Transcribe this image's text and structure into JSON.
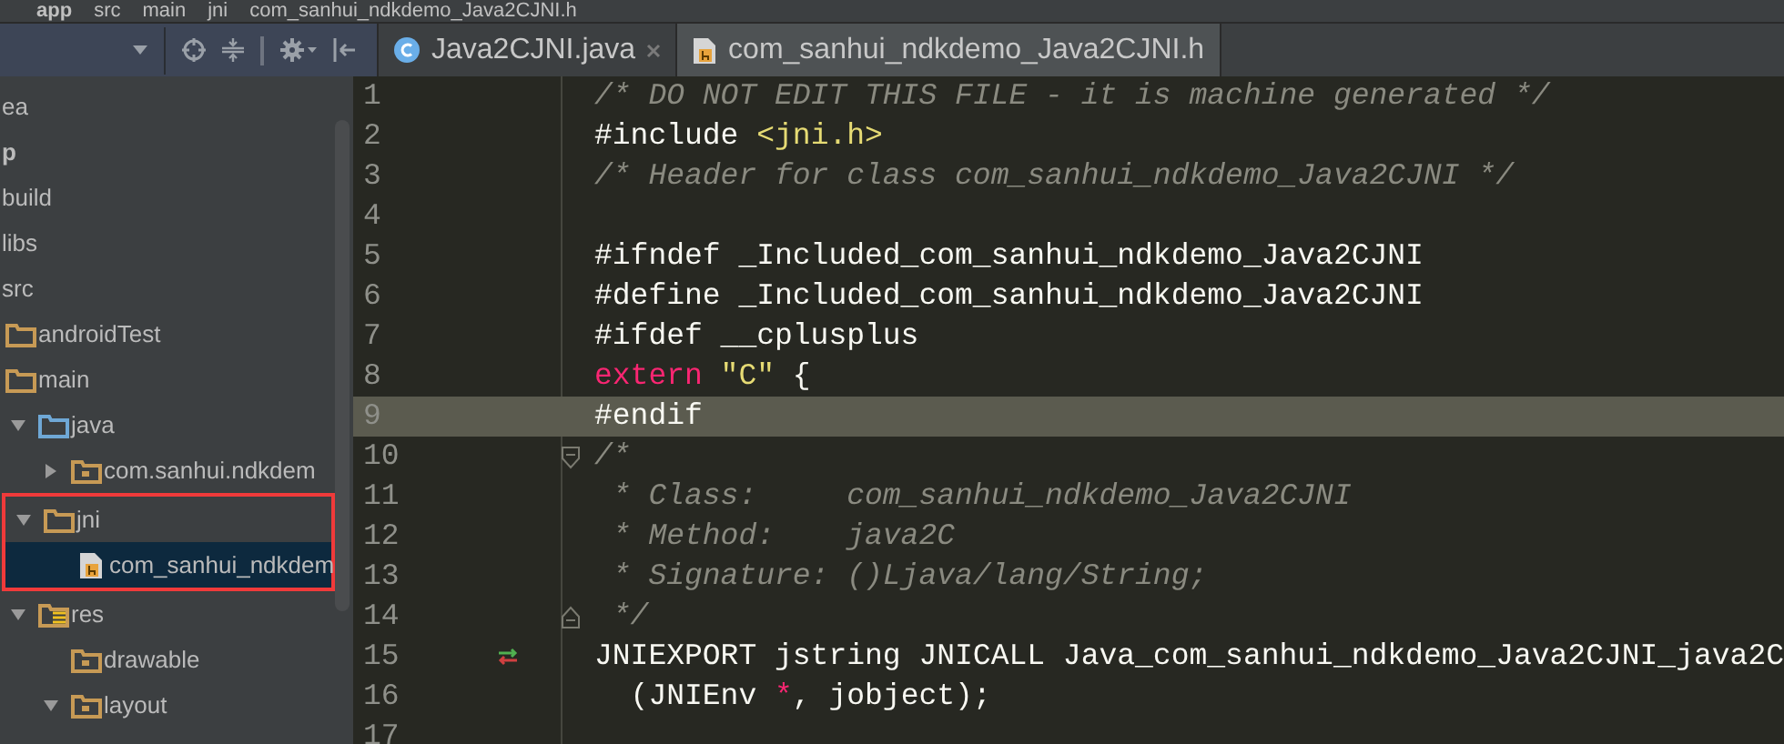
{
  "breadcrumbs": [
    {
      "label": "app",
      "bold": true
    },
    {
      "label": "src",
      "bold": false
    },
    {
      "label": "main",
      "bold": false
    },
    {
      "label": "jni",
      "bold": false
    },
    {
      "label": "com_sanhui_ndkdemo_Java2CJNI.h",
      "bold": false
    }
  ],
  "tabs": [
    {
      "label": "Java2CJNI.java",
      "kind": "class",
      "selected": false,
      "closable": true
    },
    {
      "label": "com_sanhui_ndkdemo_Java2CJNI.h",
      "kind": "header",
      "selected": true,
      "closable": false
    }
  ],
  "tree": [
    {
      "label": "ea",
      "bold": false
    },
    {
      "label": "p",
      "bold": true,
      "children": [
        {
          "label": "build",
          "bold": false
        },
        {
          "label": "libs",
          "bold": false
        },
        {
          "label": "src",
          "bold": false,
          "children": [
            {
              "label": "androidTest",
              "kind": "folder",
              "bold": false
            },
            {
              "label": "main",
              "kind": "folder",
              "bold": false,
              "children": [
                {
                  "label": "java",
                  "kind": "sources",
                  "expanded": true,
                  "bold": false,
                  "children": [
                    {
                      "label": "com.sanhui.ndkdem",
                      "kind": "package",
                      "expanded": false,
                      "bold": false
                    }
                  ]
                },
                {
                  "label": "jni",
                  "kind": "folder",
                  "expanded": true,
                  "outlined": true,
                  "bold": false,
                  "children": [
                    {
                      "label": "com_sanhui_ndkdem",
                      "kind": "header",
                      "selected": true,
                      "bold": false
                    }
                  ]
                },
                {
                  "label": "res",
                  "kind": "resources",
                  "expanded": true,
                  "bold": false,
                  "children": [
                    {
                      "label": "drawable",
                      "kind": "package",
                      "bold": false
                    },
                    {
                      "label": "layout",
                      "kind": "package",
                      "expanded": true,
                      "bold": false
                    }
                  ]
                }
              ]
            }
          ]
        }
      ]
    }
  ],
  "code": [
    {
      "number": "1",
      "kind": "plain",
      "current": false,
      "marker": false,
      "tokens": [
        {
          "kind": "comment",
          "text": "/* DO NOT EDIT THIS FILE - it is machine generated */"
        }
      ]
    },
    {
      "number": "2",
      "kind": "plain",
      "current": false,
      "marker": false,
      "tokens": [
        {
          "kind": "plain",
          "text": "#include "
        },
        {
          "kind": "string",
          "text": "<jni.h>"
        }
      ]
    },
    {
      "number": "3",
      "kind": "plain",
      "current": false,
      "marker": false,
      "tokens": [
        {
          "kind": "comment",
          "text": "/* Header for class com_sanhui_ndkdemo_Java2CJNI */"
        }
      ]
    },
    {
      "number": "4",
      "kind": "plain",
      "current": false,
      "marker": false
    },
    {
      "number": "5",
      "kind": "plain",
      "current": false,
      "marker": false,
      "tokens": [
        {
          "kind": "plain",
          "text": "#ifndef _Included_com_sanhui_ndkdemo_Java2CJNI"
        }
      ]
    },
    {
      "number": "6",
      "kind": "plain",
      "current": false,
      "marker": false,
      "tokens": [
        {
          "kind": "plain",
          "text": "#define _Included_com_sanhui_ndkdemo_Java2CJNI"
        }
      ]
    },
    {
      "number": "7",
      "kind": "plain",
      "current": false,
      "marker": false,
      "tokens": [
        {
          "kind": "plain",
          "text": "#ifdef __cplusplus"
        }
      ]
    },
    {
      "number": "8",
      "kind": "plain",
      "current": false,
      "marker": false,
      "tokens": [
        {
          "kind": "keyword",
          "text": "extern"
        },
        {
          "kind": "string",
          "text": " \"C\""
        },
        {
          "kind": "plain",
          "text": " {"
        }
      ]
    },
    {
      "number": "9",
      "kind": "plain",
      "current": true,
      "marker": false,
      "tokens": [
        {
          "kind": "plain",
          "text": "#endif"
        }
      ]
    },
    {
      "number": "10",
      "kind": "foldstart",
      "current": false,
      "marker": false,
      "tokens": [
        {
          "kind": "comment",
          "text": "/*"
        }
      ]
    },
    {
      "number": "11",
      "kind": "plain",
      "current": false,
      "marker": false,
      "tokens": [
        {
          "kind": "comment",
          "text": " * Class:     com_sanhui_ndkdemo_Java2CJNI"
        }
      ]
    },
    {
      "number": "12",
      "kind": "plain",
      "current": false,
      "marker": false,
      "tokens": [
        {
          "kind": "comment",
          "text": " * Method:    java2C"
        }
      ]
    },
    {
      "number": "13",
      "kind": "plain",
      "current": false,
      "marker": false,
      "tokens": [
        {
          "kind": "comment",
          "text": " * Signature: ()Ljava/lang/String;"
        }
      ]
    },
    {
      "number": "14",
      "kind": "foldend",
      "current": false,
      "marker": false,
      "tokens": [
        {
          "kind": "comment",
          "text": " */"
        }
      ]
    },
    {
      "number": "15",
      "kind": "plain",
      "current": false,
      "marker": true,
      "tokens": [
        {
          "kind": "plain",
          "text": "JNIEXPORT jstring JNICALL Java_com_sanhui_ndkdemo_Java2CJNI_java2C"
        }
      ]
    },
    {
      "number": "16",
      "kind": "plain",
      "current": false,
      "marker": false,
      "tokens": [
        {
          "kind": "plain",
          "text": "  (JNIEnv "
        },
        {
          "kind": "keyword",
          "text": "*"
        },
        {
          "kind": "plain",
          "text": ", jobject);"
        }
      ]
    },
    {
      "number": "17",
      "kind": "plain",
      "current": false,
      "marker": false
    }
  ]
}
